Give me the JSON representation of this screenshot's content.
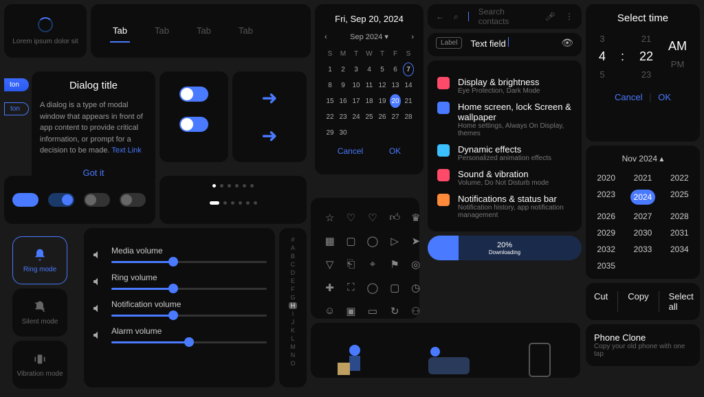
{
  "spinner": {
    "caption": "Lorem ipsum dolor sit"
  },
  "tabs": [
    "Tab",
    "Tab",
    "Tab",
    "Tab"
  ],
  "dialog": {
    "title": "Dialog title",
    "body": "A dialog is a type of modal window that appears in front of app content to provide critical information, or prompt for a decision to be made.",
    "link": "Text Link",
    "confirm": "Got it"
  },
  "buttons": {
    "primary": "ton",
    "outline": "ton"
  },
  "calendar": {
    "title": "Fri, Sep 20, 2024",
    "month": "Sep 2024",
    "weekdays": [
      "S",
      "M",
      "T",
      "W",
      "T",
      "F",
      "S"
    ],
    "days": [
      1,
      2,
      3,
      4,
      5,
      6,
      7,
      8,
      9,
      10,
      11,
      12,
      13,
      14,
      15,
      16,
      17,
      18,
      19,
      20,
      21,
      22,
      23,
      24,
      25,
      26,
      27,
      28,
      29,
      30
    ],
    "today": 7,
    "selected": 20,
    "cancel": "Cancel",
    "ok": "OK"
  },
  "index_letters": [
    "#",
    "A",
    "B",
    "C",
    "D",
    "E",
    "F",
    "G",
    "H",
    "I",
    "J",
    "K",
    "L",
    "M",
    "N",
    "O"
  ],
  "index_highlight": "H",
  "modes": {
    "ring": "Ring mode",
    "silent": "Silent mode",
    "vibration": "Vibration mode"
  },
  "sliders": [
    {
      "label": "Media volume",
      "value": 40,
      "icon": "volume"
    },
    {
      "label": "Ring volume",
      "value": 40,
      "icon": "bell"
    },
    {
      "label": "Notification volume",
      "value": 40,
      "icon": "bell-slash"
    },
    {
      "label": "Alarm volume",
      "value": 50,
      "icon": "alarm"
    }
  ],
  "search": {
    "placeholder": "Search contacts"
  },
  "textfield": {
    "label": "Label",
    "value": "Text field"
  },
  "settings": [
    {
      "title": "Display & brightness",
      "sub": "Eye Protection, Dark Mode",
      "color": "#ff4a6a"
    },
    {
      "title": "Home screen, lock Screen & wallpaper",
      "sub": "Home settings, Always On Display, themes",
      "color": "#4a7aff"
    },
    {
      "title": "Dynamic effects",
      "sub": "Personalized animation effects",
      "color": "#3ac0ff"
    },
    {
      "title": "Sound & vibration",
      "sub": "Volume, Do Not Disturb mode",
      "color": "#ff4a6a"
    },
    {
      "title": "Notifications & status bar",
      "sub": "Notification history, app notification management",
      "color": "#ff8a3a"
    }
  ],
  "progress": {
    "percent": "20%",
    "label": "Downloading"
  },
  "timepicker": {
    "title": "Select time",
    "rows": [
      [
        "3",
        "21",
        ""
      ],
      [
        "4",
        "22",
        "AM"
      ],
      [
        "5",
        "23",
        "PM"
      ]
    ],
    "cancel": "Cancel",
    "ok": "OK"
  },
  "yearpicker": {
    "month": "Nov 2024",
    "years": [
      2020,
      2021,
      2022,
      2023,
      2024,
      2025,
      2026,
      2027,
      2028,
      2029,
      2030,
      2031,
      2032,
      2033,
      2034,
      2035
    ],
    "selected": 2024,
    "extra": [
      2022,
      2025,
      2028,
      2031,
      2034
    ]
  },
  "ctx": [
    "Cut",
    "Copy",
    "Select all"
  ],
  "phone_clone": {
    "title": "Phone Clone",
    "sub": "Copy your old phone with one tap"
  }
}
